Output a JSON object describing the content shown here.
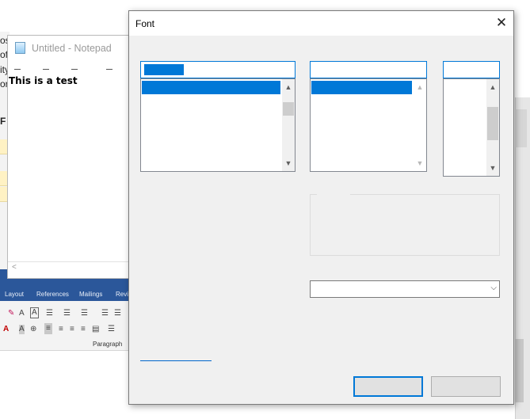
{
  "notepad": {
    "title": "Untitled - Notepad",
    "content": "This is a test"
  },
  "background_word": {
    "left_fragments": [
      "os",
      "of",
      "ity",
      "or",
      "F"
    ],
    "tabs": [
      "Layout",
      "References",
      "Mailings",
      "Revi"
    ],
    "paragraph_group_label": "Paragraph"
  },
  "font_dialog": {
    "title": "Font",
    "close_glyph": "✕"
  },
  "icons": {
    "scroll_up": "up-arrow-icon",
    "scroll_down": "down-arrow-icon",
    "dropdown": "chevron-down-icon",
    "close": "close-icon"
  },
  "glyphs": {
    "up": "▲",
    "down": "▼",
    "left": "<",
    "chevron": "⌵"
  },
  "colors": {
    "accent": "#0078d7",
    "word_blue": "#2b579a"
  }
}
